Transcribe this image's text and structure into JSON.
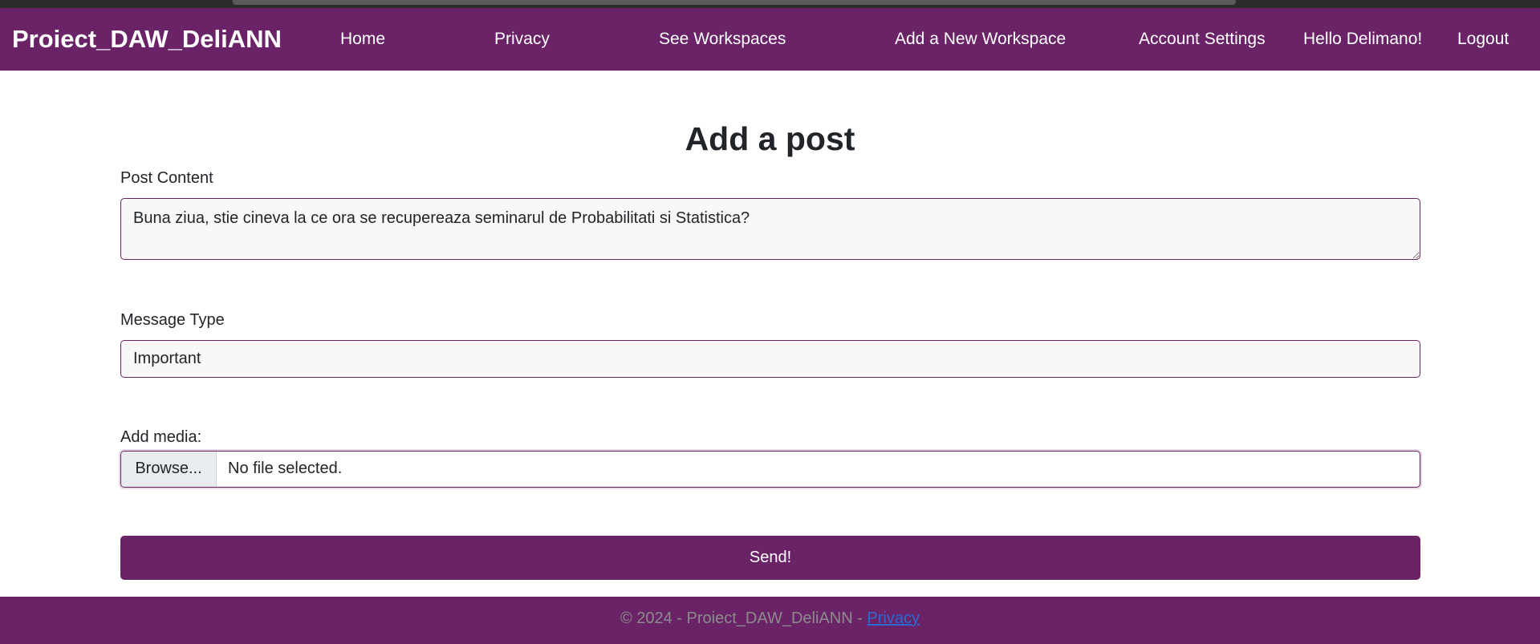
{
  "navbar": {
    "brand": "Proiect_DAW_DeliANN",
    "links": [
      "Home",
      "Privacy",
      "See Workspaces",
      "Add a New Workspace",
      "Account Settings",
      "Hello Delimano!",
      "Logout"
    ]
  },
  "page": {
    "title": "Add a post"
  },
  "form": {
    "post_content_label": "Post Content",
    "post_content_value": "Buna ziua, stie cineva la ce ora se recupereaza seminarul de Probabilitati si Statistica?",
    "message_type_label": "Message Type",
    "message_type_value": "Important",
    "media_label": "Add media:",
    "browse_label": "Browse...",
    "no_file_text": "No file selected.",
    "submit_label": "Send!"
  },
  "footer": {
    "text": "© 2024 - Proiect_DAW_DeliANN - ",
    "privacy_link": "Privacy"
  },
  "colors": {
    "brand_purple": "#6a2366",
    "footer_text": "#8c8c8c",
    "link_blue": "#2a6ad3"
  }
}
